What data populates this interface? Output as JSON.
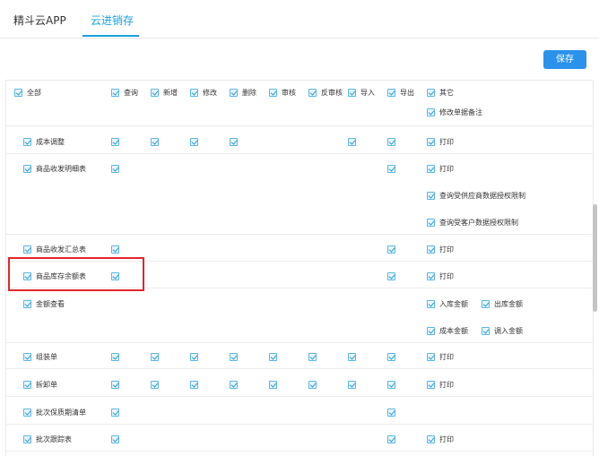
{
  "tabs": [
    {
      "label": "精斗云APP",
      "active": false
    },
    {
      "label": "云进销存",
      "active": true
    }
  ],
  "save_label": "保存",
  "header": {
    "all_label": "全部",
    "columns": [
      "查询",
      "新增",
      "修改",
      "删除",
      "审核",
      "反审核",
      "导入",
      "导出"
    ],
    "other_label": "其它"
  },
  "extra_lines": [
    {
      "other_items": [
        "修改单据备注"
      ]
    }
  ],
  "rows": [
    {
      "name": "成本调整",
      "perms": [
        "查询",
        "新增",
        "修改",
        "删除",
        "导入",
        "导出"
      ],
      "other_items": [
        "打印"
      ]
    },
    {
      "name": "商品收发明细表",
      "perms": [
        "查询",
        "导出"
      ],
      "other_items": [
        "打印",
        "查询受供应商数据授权限制",
        "查询受客户数据授权限制"
      ]
    },
    {
      "name": "商品收发汇总表",
      "perms": [
        "查询",
        "导出"
      ],
      "other_items": [
        "打印"
      ]
    },
    {
      "name": "商品库存余额表",
      "perms": [
        "查询",
        "导出"
      ],
      "other_items": [
        "打印"
      ],
      "highlighted": true
    },
    {
      "name": "金额查看",
      "perms": [],
      "other_items": [
        "入库金额",
        "出库金额",
        "成本金额",
        "调入金额"
      ]
    },
    {
      "name": "组装单",
      "perms": [
        "查询",
        "新增",
        "修改",
        "删除",
        "审核",
        "反审核",
        "导入",
        "导出"
      ],
      "other_items": [
        "打印"
      ]
    },
    {
      "name": "拆卸单",
      "perms": [
        "查询",
        "新增",
        "修改",
        "删除",
        "审核",
        "反审核",
        "导入",
        "导出"
      ],
      "other_items": [
        "打印"
      ]
    },
    {
      "name": "批次保质期清单",
      "perms": [
        "查询",
        "导出"
      ],
      "other_items": []
    },
    {
      "name": "批次跟踪表",
      "perms": [
        "查询",
        "导出"
      ],
      "other_items": [
        "打印"
      ]
    }
  ],
  "colors": {
    "accent": "#1aa1d8",
    "button": "#2a92ea",
    "highlight": "#e2262c",
    "checkbox": "#5bb7e6"
  }
}
